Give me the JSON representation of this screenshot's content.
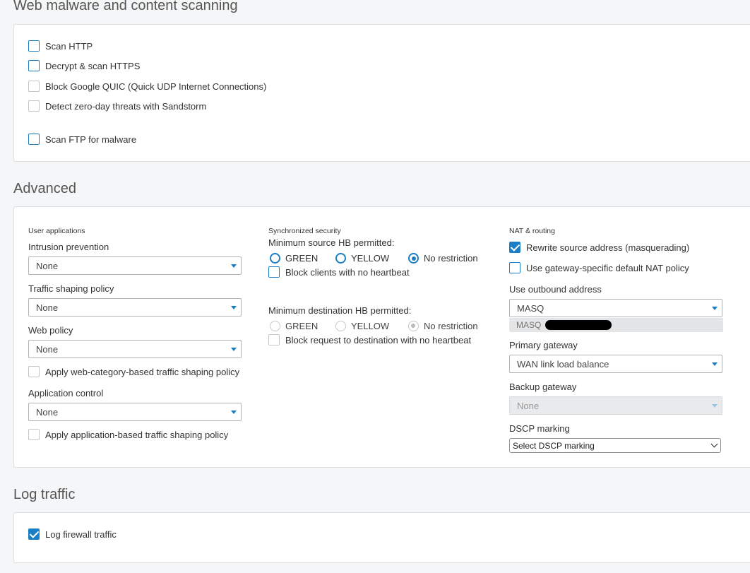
{
  "web_scanning": {
    "title": "Web malware and content scanning",
    "options": [
      {
        "label": "Scan HTTP",
        "checked": false,
        "enabled": true
      },
      {
        "label": "Decrypt & scan HTTPS",
        "checked": false,
        "enabled": true
      },
      {
        "label": "Block Google QUIC (Quick UDP Internet Connections)",
        "checked": false,
        "enabled": false
      },
      {
        "label": "Detect zero-day threats with Sandstorm",
        "checked": false,
        "enabled": false
      },
      {
        "label": "Scan FTP for malware",
        "checked": false,
        "enabled": true
      }
    ]
  },
  "advanced": {
    "title": "Advanced",
    "user_apps": {
      "heading": "User applications",
      "intrusion_label": "Intrusion prevention",
      "intrusion_value": "None",
      "traffic_label": "Traffic shaping policy",
      "traffic_value": "None",
      "web_label": "Web policy",
      "web_value": "None",
      "web_category_option": "Apply web-category-based traffic shaping policy",
      "appctrl_label": "Application control",
      "appctrl_value": "None",
      "app_based_option": "Apply application-based traffic shaping policy"
    },
    "sync_security": {
      "heading": "Synchronized security",
      "min_source_label": "Minimum source HB permitted:",
      "source_options": [
        "GREEN",
        "YELLOW",
        "No restriction"
      ],
      "source_selected": "No restriction",
      "block_clients_label": "Block clients with no heartbeat",
      "min_dest_label": "Minimum destination HB permitted:",
      "dest_options": [
        "GREEN",
        "YELLOW",
        "No restriction"
      ],
      "dest_selected": "No restriction",
      "block_dest_label": "Block request to destination with no heartbeat"
    },
    "nat": {
      "heading": "NAT & routing",
      "rewrite_label": "Rewrite source address (masquerading)",
      "rewrite_checked": true,
      "gateway_nat_label": "Use gateway-specific default NAT policy",
      "outbound_label": "Use outbound address",
      "outbound_value": "MASQ",
      "outbound_chip": "MASQ",
      "primary_label": "Primary gateway",
      "primary_value": "WAN link load balance",
      "backup_label": "Backup gateway",
      "backup_value": "None",
      "dscp_label": "DSCP marking",
      "dscp_value": "Select DSCP marking"
    }
  },
  "log_traffic": {
    "title": "Log traffic",
    "log_label": "Log firewall traffic",
    "log_checked": true
  },
  "colors": {
    "accent": "#1a7ec4",
    "panel_bg": "#ffffff",
    "page_bg": "#f5f6f7"
  }
}
